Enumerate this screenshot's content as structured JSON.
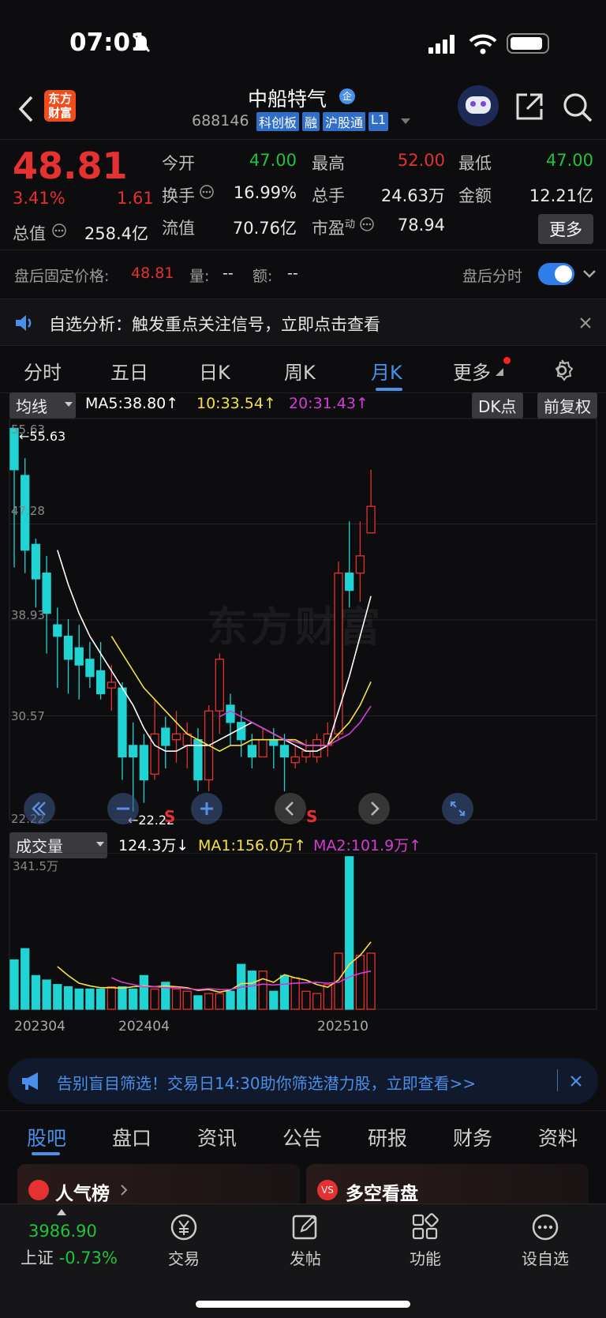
{
  "status": {
    "time": "07:01"
  },
  "header": {
    "logo": "东方\n财富",
    "stock_name": "中船特气",
    "tag_enterprise": "企",
    "code": "688146",
    "badges": [
      "科创板",
      "融",
      "沪股通",
      "L1"
    ]
  },
  "quote": {
    "price": "48.81",
    "change_pct": "3.41%",
    "change": "1.61",
    "open_label": "今开",
    "open": "47.00",
    "high_label": "最高",
    "high": "52.00",
    "low_label": "最低",
    "low": "47.00",
    "turnover_label": "换手",
    "turnover": "16.99%",
    "volume_label": "总手",
    "volume": "24.63万",
    "amount_label": "金额",
    "amount": "12.21亿",
    "mktcap_label": "总值",
    "mktcap": "258.4亿",
    "float_label": "流值",
    "float": "70.76亿",
    "pe_label": "市盈",
    "pe_sup": "动",
    "pe": "78.94",
    "more": "更多"
  },
  "after_hours": {
    "label": "盘后固定价格:",
    "price": "48.81",
    "vol_label": "量:",
    "vol": "--",
    "amt_label": "额:",
    "amt": "--",
    "toggle_label": "盘后分时"
  },
  "notice": {
    "text": "自选分析：触发重点关注信号，立即点击查看"
  },
  "tabs": [
    "分时",
    "五日",
    "日K",
    "周K",
    "月K",
    "更多"
  ],
  "active_tab": "月K",
  "indicator": {
    "ma_select": "均线",
    "ma5": "MA5:38.80",
    "ma10": "10:33.54",
    "ma20": "20:31.43",
    "dk": "DK点",
    "adjust": "前复权"
  },
  "price_axis": [
    "55.63",
    "47.28",
    "38.93",
    "30.57",
    "22.22"
  ],
  "markers": {
    "max": "←55.63",
    "min": "←22.22",
    "s1": "S",
    "s2": "S",
    "watermark": "东方财富"
  },
  "volume": {
    "select": "成交量",
    "value": "124.3万",
    "ma1": "MA1:156.0万",
    "ma2": "MA2:101.9万",
    "max_label": "341.5万",
    "x_labels": [
      "202304",
      "202404",
      "202510"
    ]
  },
  "colors": {
    "up": "#e5312f",
    "down": "#21d4d4",
    "ma5": "#ffffff",
    "ma10": "#f5e142",
    "ma20": "#d63bd6",
    "accent": "#4a8fe8"
  },
  "chart_data": {
    "type": "candlestick",
    "ylim": [
      22.22,
      55.63
    ],
    "candles": [
      {
        "o": 55.6,
        "c": 52.0,
        "h": 55.6,
        "l": 43.5
      },
      {
        "o": 51.5,
        "c": 45.0,
        "h": 53.0,
        "l": 43.0
      },
      {
        "o": 45.5,
        "c": 42.5,
        "h": 46.0,
        "l": 40.0
      },
      {
        "o": 43.0,
        "c": 39.5,
        "h": 44.5,
        "l": 36.0
      },
      {
        "o": 38.5,
        "c": 37.5,
        "h": 40.0,
        "l": 33.0
      },
      {
        "o": 37.5,
        "c": 35.5,
        "h": 39.0,
        "l": 32.5
      },
      {
        "o": 36.5,
        "c": 35.0,
        "h": 38.5,
        "l": 32.0
      },
      {
        "o": 35.5,
        "c": 34.0,
        "h": 37.0,
        "l": 33.0
      },
      {
        "o": 34.5,
        "c": 32.5,
        "h": 37.0,
        "l": 32.0
      },
      {
        "o": 33.0,
        "c": 33.5,
        "h": 35.0,
        "l": 31.0
      },
      {
        "o": 33.0,
        "c": 27.0,
        "h": 33.5,
        "l": 25.0
      },
      {
        "o": 28.0,
        "c": 27.0,
        "h": 30.0,
        "l": 22.22
      },
      {
        "o": 28.0,
        "c": 25.0,
        "h": 29.0,
        "l": 23.0
      },
      {
        "o": 25.5,
        "c": 29.0,
        "h": 32.0,
        "l": 25.0
      },
      {
        "o": 29.5,
        "c": 28.0,
        "h": 30.5,
        "l": 26.0
      },
      {
        "o": 28.5,
        "c": 29.0,
        "h": 31.0,
        "l": 26.5
      },
      {
        "o": 28.0,
        "c": 29.0,
        "h": 30.0,
        "l": 26.0
      },
      {
        "o": 28.5,
        "c": 25.0,
        "h": 29.5,
        "l": 24.0
      },
      {
        "o": 25.0,
        "c": 31.0,
        "h": 31.5,
        "l": 24.0
      },
      {
        "o": 31.0,
        "c": 35.5,
        "h": 36.0,
        "l": 29.0
      },
      {
        "o": 31.5,
        "c": 30.0,
        "h": 32.5,
        "l": 28.0
      },
      {
        "o": 30.0,
        "c": 28.5,
        "h": 31.0,
        "l": 27.0
      },
      {
        "o": 28.0,
        "c": 27.0,
        "h": 29.0,
        "l": 26.0
      },
      {
        "o": 27.0,
        "c": 28.5,
        "h": 29.5,
        "l": 27.0
      },
      {
        "o": 28.5,
        "c": 28.0,
        "h": 29.5,
        "l": 26.0
      },
      {
        "o": 28.0,
        "c": 27.0,
        "h": 29.0,
        "l": 24.0
      },
      {
        "o": 26.5,
        "c": 27.0,
        "h": 28.0,
        "l": 26.0
      },
      {
        "o": 27.0,
        "c": 27.5,
        "h": 28.5,
        "l": 26.5
      },
      {
        "o": 27.0,
        "c": 28.5,
        "h": 29.0,
        "l": 26.5
      },
      {
        "o": 28.0,
        "c": 29.0,
        "h": 30.0,
        "l": 27.0
      },
      {
        "o": 29.0,
        "c": 43.0,
        "h": 44.0,
        "l": 28.5
      },
      {
        "o": 43.0,
        "c": 41.5,
        "h": 47.5,
        "l": 40.0
      },
      {
        "o": 43.0,
        "c": 44.5,
        "h": 47.5,
        "l": 40.5
      },
      {
        "o": 46.5,
        "c": 48.81,
        "h": 52.0,
        "l": 47.0
      }
    ],
    "ma5": [
      null,
      null,
      null,
      null,
      45.0,
      42.0,
      39.5,
      37.5,
      36.0,
      34.5,
      33.0,
      31.5,
      29.5,
      28.0,
      27.5,
      27.5,
      28.0,
      28.0,
      28.0,
      28.5,
      29.0,
      29.5,
      30.0,
      29.5,
      29.0,
      28.5,
      28.0,
      27.5,
      27.5,
      28.0,
      31.0,
      34.0,
      37.5,
      41.0
    ],
    "ma10": [
      null,
      null,
      null,
      null,
      null,
      null,
      null,
      null,
      null,
      37.5,
      36.0,
      34.5,
      33.0,
      32.0,
      31.0,
      30.0,
      29.0,
      28.5,
      28.0,
      27.5,
      28.0,
      28.0,
      28.5,
      28.5,
      28.5,
      28.5,
      28.5,
      28.0,
      28.0,
      28.0,
      29.0,
      30.0,
      31.5,
      33.54
    ],
    "ma20": [
      null,
      null,
      null,
      null,
      null,
      null,
      null,
      null,
      null,
      null,
      null,
      null,
      null,
      null,
      null,
      null,
      null,
      null,
      null,
      30.5,
      31.0,
      30.5,
      30.0,
      29.5,
      29.0,
      28.5,
      28.3,
      28.0,
      28.0,
      28.0,
      28.5,
      29.0,
      30.0,
      31.43
    ],
    "volumes": [
      110,
      135,
      75,
      65,
      55,
      50,
      45,
      45,
      45,
      50,
      50,
      45,
      75,
      45,
      60,
      45,
      40,
      30,
      35,
      35,
      40,
      100,
      85,
      85,
      40,
      75,
      70,
      40,
      35,
      55,
      125,
      340,
      120,
      125
    ],
    "vol_ma1": [
      null,
      null,
      null,
      null,
      95,
      75,
      58,
      52,
      48,
      48,
      47,
      50,
      52,
      50,
      52,
      50,
      48,
      42,
      44,
      38,
      43,
      57,
      58,
      68,
      60,
      77,
      70,
      65,
      55,
      49,
      65,
      100,
      120,
      150
    ],
    "vol_ma2": [
      null,
      null,
      null,
      null,
      null,
      null,
      null,
      null,
      null,
      70,
      60,
      55,
      50,
      50,
      48,
      48,
      46,
      44,
      46,
      44,
      44,
      49,
      52,
      56,
      54,
      56,
      58,
      59,
      60,
      58,
      60,
      72,
      80,
      85
    ]
  },
  "bottom_ad": {
    "text": "告别盲目筛选！交易日14:30助你筛选潜力股，立即查看>>"
  },
  "bottom_tabs": [
    "股吧",
    "盘口",
    "资讯",
    "公告",
    "研报",
    "财务",
    "资料"
  ],
  "cards": {
    "left": "人气榜",
    "right": "多空看盘"
  },
  "tabbar": {
    "index_value": "3986.90",
    "index_name": "上证",
    "index_change": "-0.73%",
    "trade": "交易",
    "post": "发帖",
    "function": "功能",
    "watchlist": "设自选"
  }
}
